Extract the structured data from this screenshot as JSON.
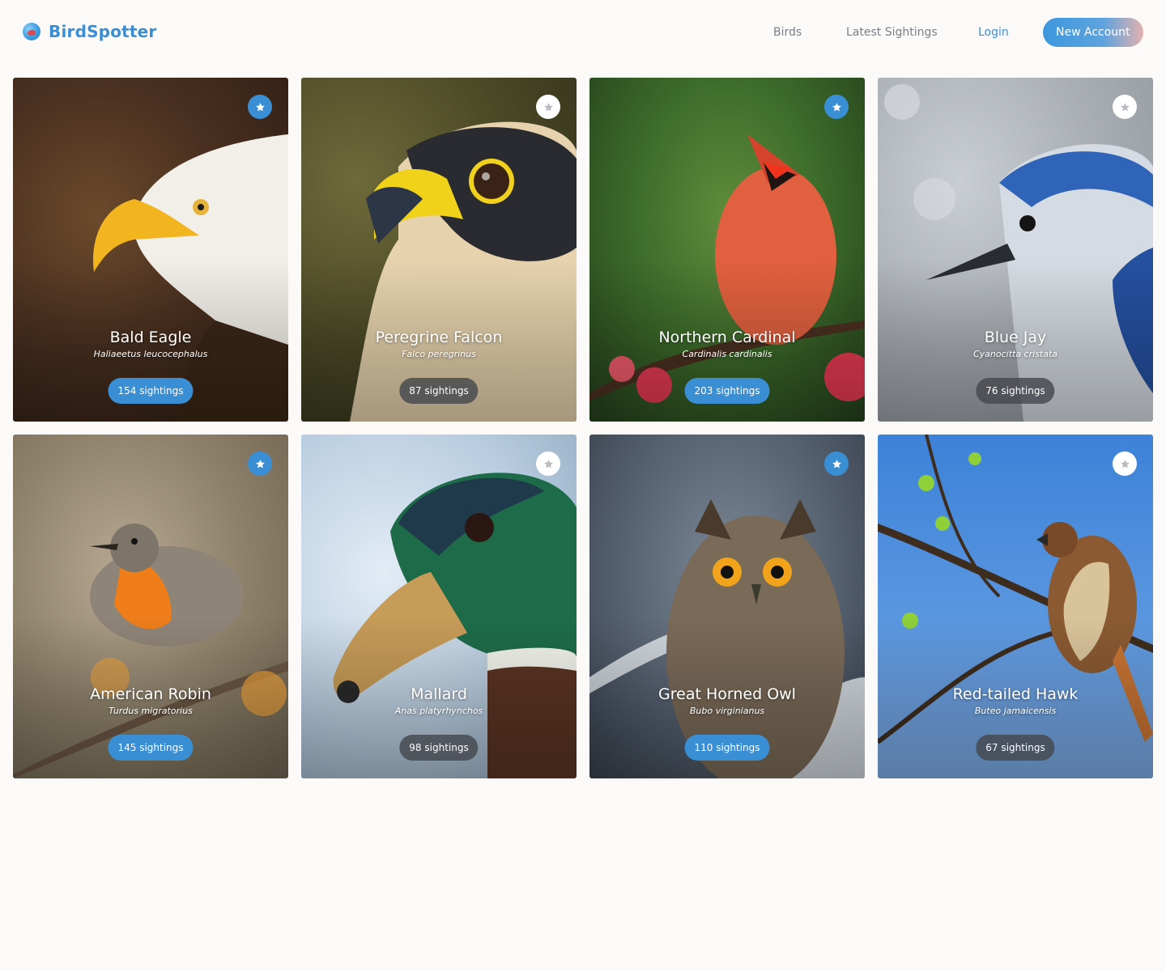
{
  "brand": {
    "name": "BirdSpotter",
    "logo_icon": "bird-logo-icon"
  },
  "nav": {
    "birds": "Birds",
    "latest": "Latest Sightings",
    "login": "Login",
    "new_account": "New Account"
  },
  "colors": {
    "accent": "#3a8fd4",
    "badge_dark": "#46484e"
  },
  "birds": [
    {
      "name": "Bald Eagle",
      "scientific": "Haliaeetus leucocephalus",
      "sightings": "154 sightings",
      "favorited": true,
      "badge_style": "blue",
      "icon": "star-icon"
    },
    {
      "name": "Peregrine Falcon",
      "scientific": "Falco peregrinus",
      "sightings": "87 sightings",
      "favorited": false,
      "badge_style": "dark",
      "icon": "star-icon"
    },
    {
      "name": "Northern Cardinal",
      "scientific": "Cardinalis cardinalis",
      "sightings": "203 sightings",
      "favorited": true,
      "badge_style": "blue",
      "icon": "star-icon"
    },
    {
      "name": "Blue Jay",
      "scientific": "Cyanocitta cristata",
      "sightings": "76 sightings",
      "favorited": false,
      "badge_style": "dark",
      "icon": "star-icon"
    },
    {
      "name": "American Robin",
      "scientific": "Turdus migratorius",
      "sightings": "145 sightings",
      "favorited": true,
      "badge_style": "blue",
      "icon": "star-icon"
    },
    {
      "name": "Mallard",
      "scientific": "Anas platyrhynchos",
      "sightings": "98 sightings",
      "favorited": false,
      "badge_style": "dark",
      "icon": "star-icon"
    },
    {
      "name": "Great Horned Owl",
      "scientific": "Bubo virginianus",
      "sightings": "110 sightings",
      "favorited": true,
      "badge_style": "blue",
      "icon": "star-icon"
    },
    {
      "name": "Red-tailed Hawk",
      "scientific": "Buteo jamaicensis",
      "sightings": "67 sightings",
      "favorited": false,
      "badge_style": "dark",
      "icon": "star-icon"
    }
  ]
}
